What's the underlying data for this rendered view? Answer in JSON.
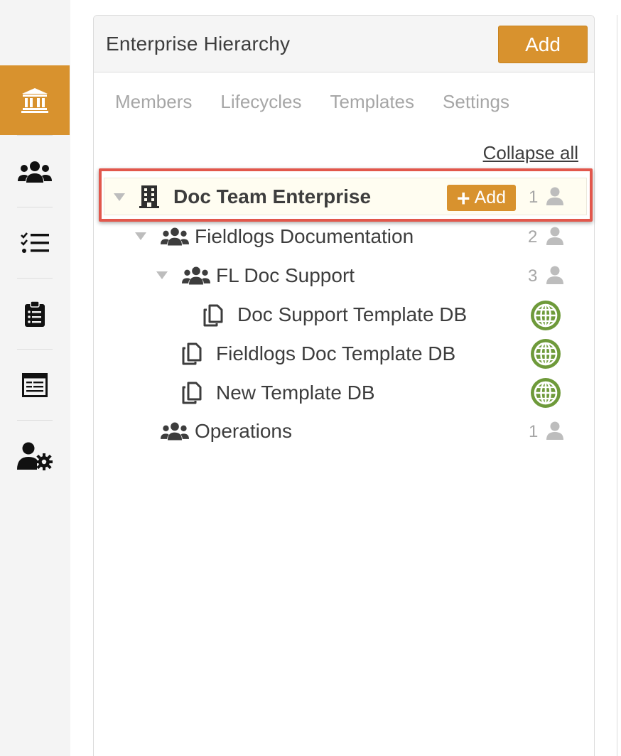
{
  "nav": {
    "items": [
      {
        "icon": "institution-icon",
        "active": true
      },
      {
        "icon": "users-icon",
        "active": false
      },
      {
        "icon": "tasks-list-icon",
        "active": false
      },
      {
        "icon": "clipboard-list-icon",
        "active": false
      },
      {
        "icon": "form-template-icon",
        "active": false
      },
      {
        "icon": "user-settings-icon",
        "active": false
      }
    ]
  },
  "panel": {
    "title": "Enterprise Hierarchy",
    "add_label": "Add",
    "tabs": [
      "Members",
      "Lifecycles",
      "Templates",
      "Settings"
    ],
    "collapse_all": "Collapse all"
  },
  "tree": {
    "root": {
      "label": "Doc Team Enterprise",
      "add_label": "Add",
      "count": "1",
      "icon": "building-icon"
    },
    "nodes": [
      {
        "label": "Fieldlogs Documentation",
        "count": "2",
        "icon": "users-icon",
        "type": "group"
      },
      {
        "label": "FL Doc Support",
        "count": "3",
        "icon": "users-icon",
        "type": "group"
      },
      {
        "label": "Doc Support Template DB",
        "icon": "copy-icon",
        "type": "template",
        "status": "globe-icon"
      },
      {
        "label": "Fieldlogs Doc Template DB",
        "icon": "copy-icon",
        "type": "template",
        "status": "globe-icon"
      },
      {
        "label": "New Template DB",
        "icon": "copy-icon",
        "type": "template",
        "status": "globe-icon"
      },
      {
        "label": "Operations",
        "count": "1",
        "icon": "users-icon",
        "type": "group"
      }
    ]
  },
  "colors": {
    "accent": "#d8922e",
    "highlight_border": "#e2574c",
    "globe": "#6e9a3a",
    "muted_text": "#a6a6a6"
  }
}
